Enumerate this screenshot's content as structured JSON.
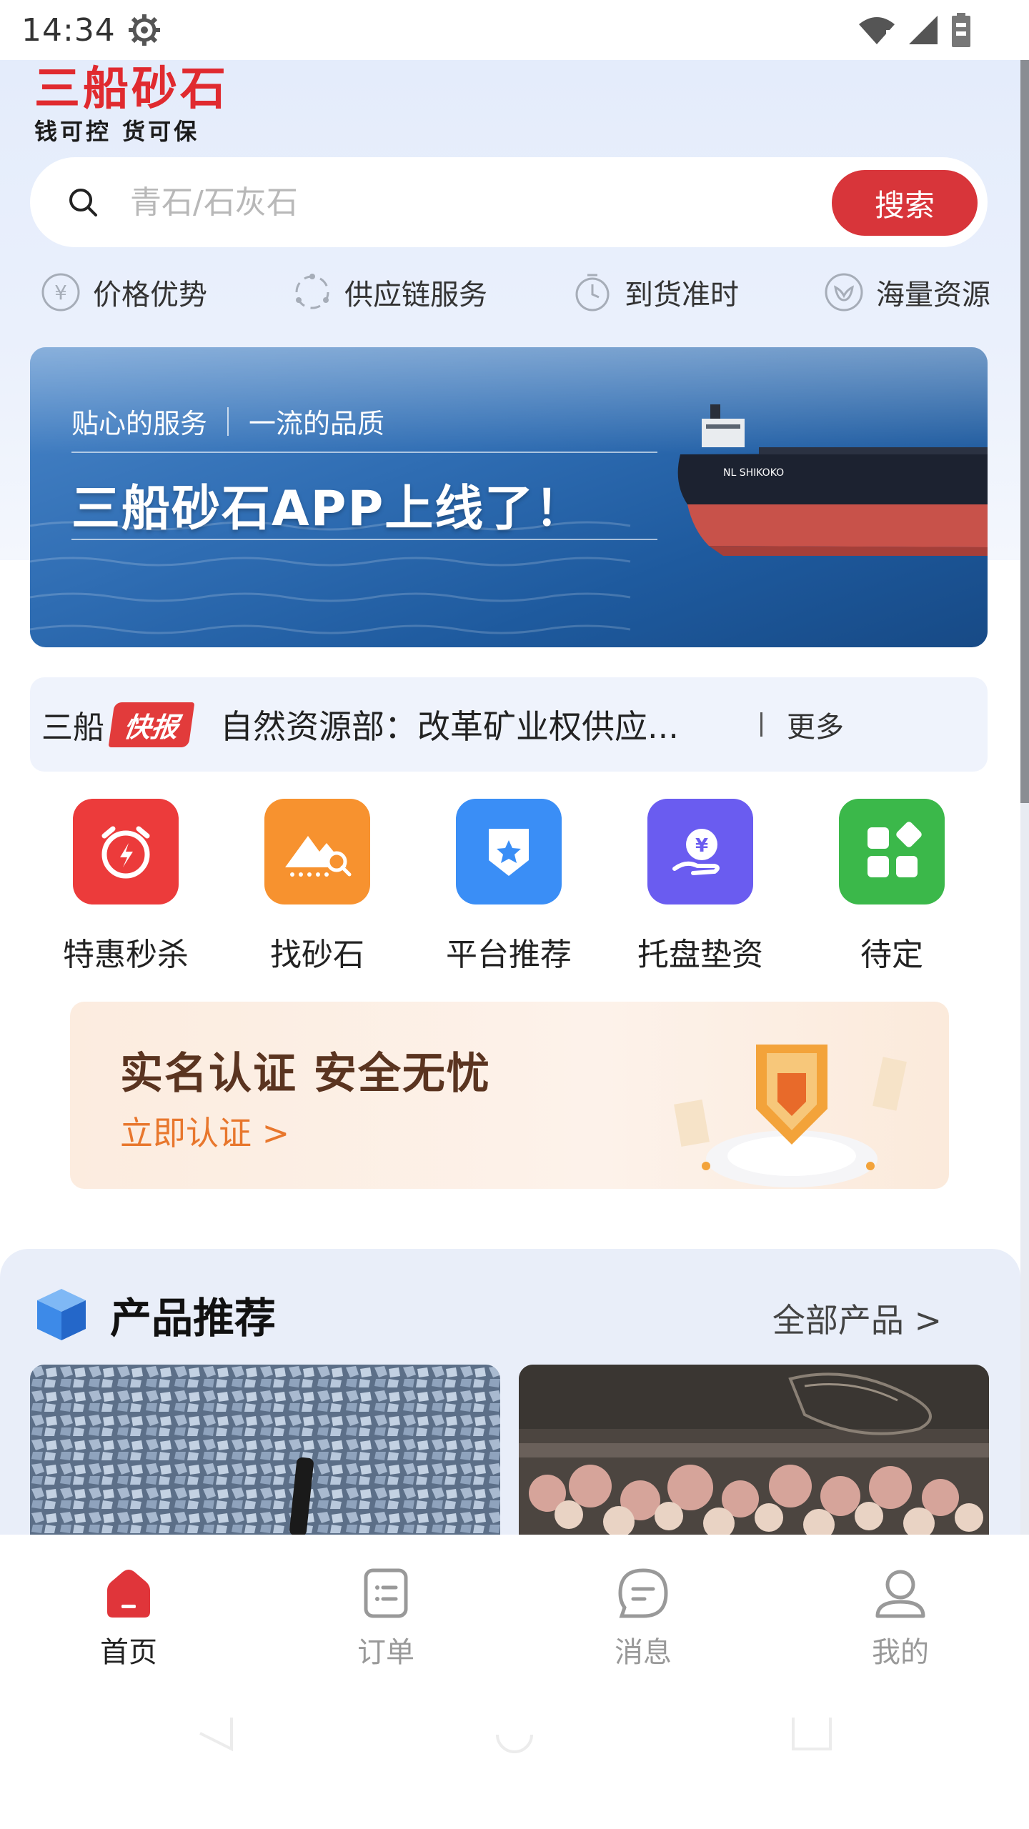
{
  "status_bar": {
    "time": "14:34"
  },
  "logo": {
    "main": "三船砂石",
    "sub": "钱可控 货可保"
  },
  "search": {
    "placeholder": "青石/石灰石",
    "button_label": "搜索"
  },
  "features": [
    {
      "icon": "yuan-icon",
      "label": "价格优势"
    },
    {
      "icon": "supply-chain-icon",
      "label": "供应链服务"
    },
    {
      "icon": "timer-icon",
      "label": "到货准时"
    },
    {
      "icon": "leaf-icon",
      "label": "海量资源"
    }
  ],
  "banner": {
    "sub_left": "贴心的服务",
    "sub_right": "一流的品质",
    "title": "三船砂石APP上线了！",
    "ship_name": "NL SHIKOKO"
  },
  "news": {
    "brand": "三船",
    "badge": "快报",
    "headline": "自然资源部：改革矿业权供应...",
    "more": "更多"
  },
  "quick_menu": [
    {
      "label": "特惠秒杀",
      "color": "#ec3b3b",
      "icon": "alarm-clock-icon"
    },
    {
      "label": "找砂石",
      "color": "#f7922f",
      "icon": "mountain-search-icon"
    },
    {
      "label": "平台推荐",
      "color": "#3a8ef6",
      "icon": "star-shield-icon"
    },
    {
      "label": "托盘垫资",
      "color": "#6a5cf0",
      "icon": "money-hand-icon"
    },
    {
      "label": "待定",
      "color": "#3bb84a",
      "icon": "grid-apps-icon"
    }
  ],
  "cert_banner": {
    "title": "实名认证 安全无忧",
    "link": "立即认证 >"
  },
  "products": {
    "title": "产品推荐",
    "all_link": "全部产品 >"
  },
  "bottom_nav": [
    {
      "label": "首页",
      "icon": "home-icon",
      "active": true
    },
    {
      "label": "订单",
      "icon": "order-icon",
      "active": false
    },
    {
      "label": "消息",
      "icon": "message-icon",
      "active": false
    },
    {
      "label": "我的",
      "icon": "profile-icon",
      "active": false
    }
  ],
  "colors": {
    "brand_red": "#d8353a",
    "accent_orange": "#e8772d",
    "page_bg": "#e9eef9"
  }
}
